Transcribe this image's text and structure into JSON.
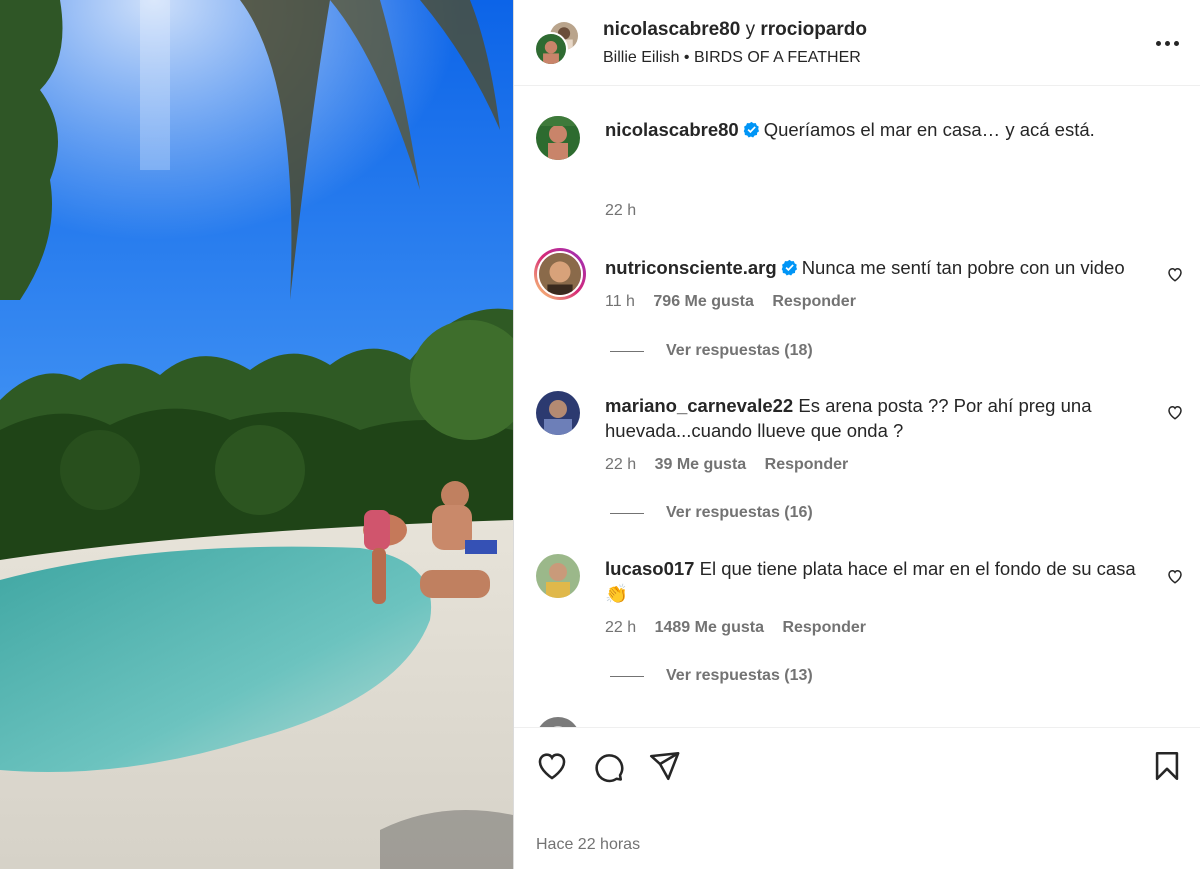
{
  "header": {
    "user1": "nicolascabre80",
    "connector": "y",
    "user2": "rrociopardo",
    "song_artist": "Billie Eilish",
    "song_sep": "•",
    "song_title": "BIRDS OF A FEATHER"
  },
  "caption": {
    "username": "nicolascabre80",
    "text": "Queríamos el mar en casa… y acá está.",
    "time": "22 h"
  },
  "comments": [
    {
      "username": "nutriconsciente.arg",
      "verified": true,
      "text": "Nunca me sentí tan pobre con un video",
      "time": "11 h",
      "likes": "796 Me gusta",
      "reply": "Responder",
      "view_replies": "Ver respuestas (18)"
    },
    {
      "username": "mariano_carnevale22",
      "verified": false,
      "text": "Es arena posta ?? Por ahí preg una huevada...cuando llueve que onda ?",
      "time": "22 h",
      "likes": "39 Me gusta",
      "reply": "Responder",
      "view_replies": "Ver respuestas (16)"
    },
    {
      "username": "lucaso017",
      "verified": false,
      "text": "El que tiene plata hace el mar en el fondo de su casa 👏",
      "time": "22 h",
      "likes": "1489 Me gusta",
      "reply": "Responder",
      "view_replies": "Ver respuestas (13)"
    }
  ],
  "footer": {
    "time_ago": "Hace 22 horas"
  },
  "icons": {
    "more": "more-options-icon",
    "verified": "verified-badge-icon",
    "like": "heart-icon",
    "comment": "comment-icon",
    "share": "send-icon",
    "save": "bookmark-icon"
  },
  "colors": {
    "text": "#262626",
    "secondary": "#737373",
    "verified": "#0095f6",
    "border": "#dbdbdb"
  }
}
